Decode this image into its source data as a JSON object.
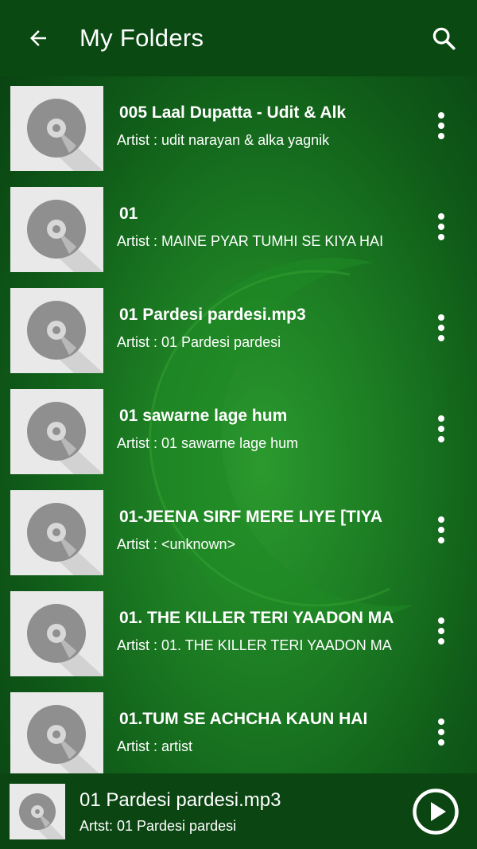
{
  "appbar": {
    "title": "My Folders",
    "back_icon": "arrow-left-icon",
    "search_icon": "search-icon"
  },
  "songs": [
    {
      "title": "005 Laal Dupatta - Udit & Alk",
      "artist": "Artist : udit narayan & alka yagnik"
    },
    {
      "title": "01",
      "artist": "Artist : MAINE PYAR TUMHI SE KIYA HAI"
    },
    {
      "title": "01 Pardesi pardesi.mp3",
      "artist": "Artist : 01 Pardesi pardesi"
    },
    {
      "title": "01 sawarne lage hum",
      "artist": "Artist : 01 sawarne lage hum"
    },
    {
      "title": "01-JEENA SIRF MERE LIYE [TIYA",
      "artist": "Artist : <unknown>"
    },
    {
      "title": "01. THE KILLER TERI YAADON MA",
      "artist": "Artist : 01. THE KILLER TERI YAADON MA"
    },
    {
      "title": "01.TUM SE ACHCHA KAUN HAI",
      "artist": "Artist : artist"
    }
  ],
  "now_playing": {
    "title": "01 Pardesi pardesi.mp3",
    "artist": "Artst: 01 Pardesi pardesi",
    "play_icon": "play-circle-icon"
  },
  "colors": {
    "appbar": "#0a4a12",
    "player_bar": "#0b4512",
    "thumb_bg": "#e9e9e9",
    "disc": "#8f8f8f"
  }
}
